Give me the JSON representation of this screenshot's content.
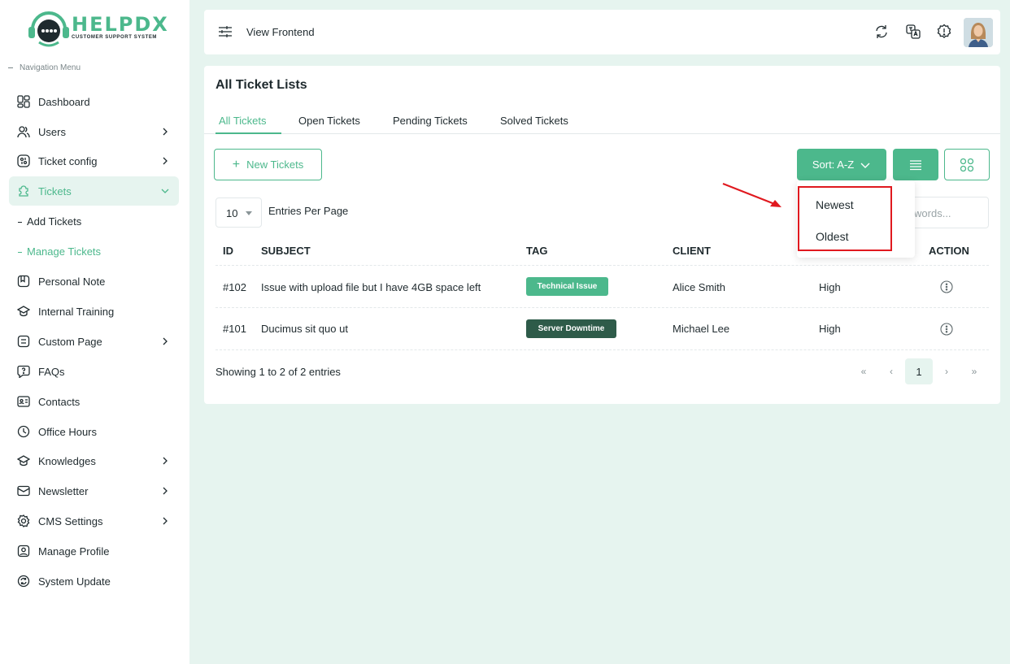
{
  "brand": {
    "name": "HELPDX",
    "tagline": "CUSTOMER SUPPORT SYSTEM",
    "accent": "#4cb88c"
  },
  "sidebar": {
    "section_title": "Navigation Menu",
    "items": [
      {
        "label": "Dashboard",
        "icon": "dashboard-icon",
        "has_children": false
      },
      {
        "label": "Users",
        "icon": "users-icon",
        "has_children": true
      },
      {
        "label": "Ticket config",
        "icon": "ticket-config-icon",
        "has_children": true
      },
      {
        "label": "Tickets",
        "icon": "tickets-icon",
        "has_children": true,
        "active": true,
        "children": [
          {
            "label": "Add Tickets"
          },
          {
            "label": "Manage Tickets",
            "active": true
          }
        ]
      },
      {
        "label": "Personal Note",
        "icon": "note-icon",
        "has_children": false
      },
      {
        "label": "Internal Training",
        "icon": "training-icon",
        "has_children": false
      },
      {
        "label": "Custom Page",
        "icon": "page-icon",
        "has_children": true
      },
      {
        "label": "FAQs",
        "icon": "faq-icon",
        "has_children": false
      },
      {
        "label": "Contacts",
        "icon": "contacts-icon",
        "has_children": false
      },
      {
        "label": "Office Hours",
        "icon": "clock-icon",
        "has_children": false
      },
      {
        "label": "Knowledges",
        "icon": "knowledge-icon",
        "has_children": true
      },
      {
        "label": "Newsletter",
        "icon": "newsletter-icon",
        "has_children": true
      },
      {
        "label": "CMS Settings",
        "icon": "settings-icon",
        "has_children": true
      },
      {
        "label": "Manage Profile",
        "icon": "profile-icon",
        "has_children": false
      },
      {
        "label": "System Update",
        "icon": "update-icon",
        "has_children": false
      }
    ]
  },
  "topbar": {
    "view_frontend": "View Frontend"
  },
  "main": {
    "title": "All Ticket Lists",
    "tabs": [
      {
        "label": "All Tickets",
        "active": true
      },
      {
        "label": "Open Tickets"
      },
      {
        "label": "Pending Tickets"
      },
      {
        "label": "Solved Tickets"
      }
    ],
    "new_button": "New Tickets",
    "sort_button": "Sort: A-Z",
    "sort_options": [
      "Newest",
      "Oldest"
    ],
    "entries_value": "10",
    "entries_label": "Entries Per Page",
    "search_placeholder": "Search keywords...",
    "columns": [
      "ID",
      "SUBJECT",
      "TAG",
      "CLIENT",
      "",
      "ACTION"
    ],
    "rows": [
      {
        "id": "#102",
        "subject": "Issue with upload file but I have 4GB space left",
        "tag": "Technical Issue",
        "tag_color": "#4cb88c",
        "client": "Alice Smith",
        "priority": "High"
      },
      {
        "id": "#101",
        "subject": "Ducimus sit quo ut",
        "tag": "Server Downtime",
        "tag_color": "#2e5b49",
        "client": "Michael Lee",
        "priority": "High"
      }
    ],
    "showing": "Showing 1 to 2 of 2 entries",
    "pagination": {
      "first": "«",
      "prev": "‹",
      "current": "1",
      "next": "›",
      "last": "»"
    }
  }
}
